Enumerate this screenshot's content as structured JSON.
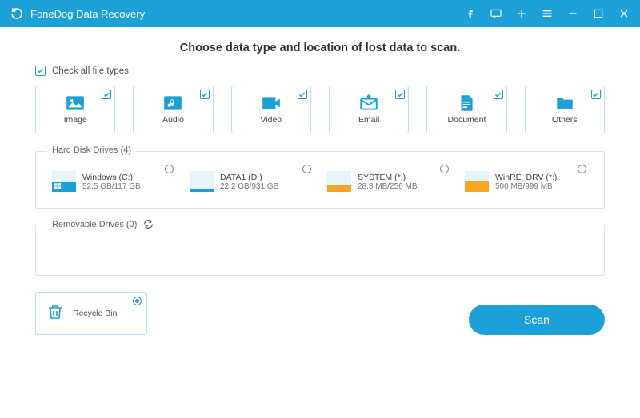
{
  "titlebar": {
    "title": "FoneDog Data Recovery"
  },
  "heading": "Choose data type and location of lost data to scan.",
  "checkall_label": "Check all file types",
  "types": {
    "image": "Image",
    "audio": "Audio",
    "video": "Video",
    "email": "Email",
    "document": "Document",
    "others": "Others"
  },
  "sections": {
    "hdd_legend": "Hard Disk Drives (4)",
    "removable_legend": "Removable Drives (0)"
  },
  "drives": [
    {
      "name": "Windows (C:)",
      "size": "52.5 GB/117 GB",
      "fill_color": "#1ba1d8",
      "fill_pct": 45,
      "os": true
    },
    {
      "name": "DATA1 (D:)",
      "size": "22.2 GB/931 GB",
      "fill_color": "#1ba1d8",
      "fill_pct": 12,
      "os": false
    },
    {
      "name": "SYSTEM (*:)",
      "size": "28.3 MB/256 MB",
      "fill_color": "#f7a524",
      "fill_pct": 35,
      "os": false
    },
    {
      "name": "WinRE_DRV (*:)",
      "size": "500 MB/999 MB",
      "fill_color": "#f7a524",
      "fill_pct": 55,
      "os": false
    }
  ],
  "recycle": {
    "label": "Recycle Bin"
  },
  "scan_label": "Scan"
}
